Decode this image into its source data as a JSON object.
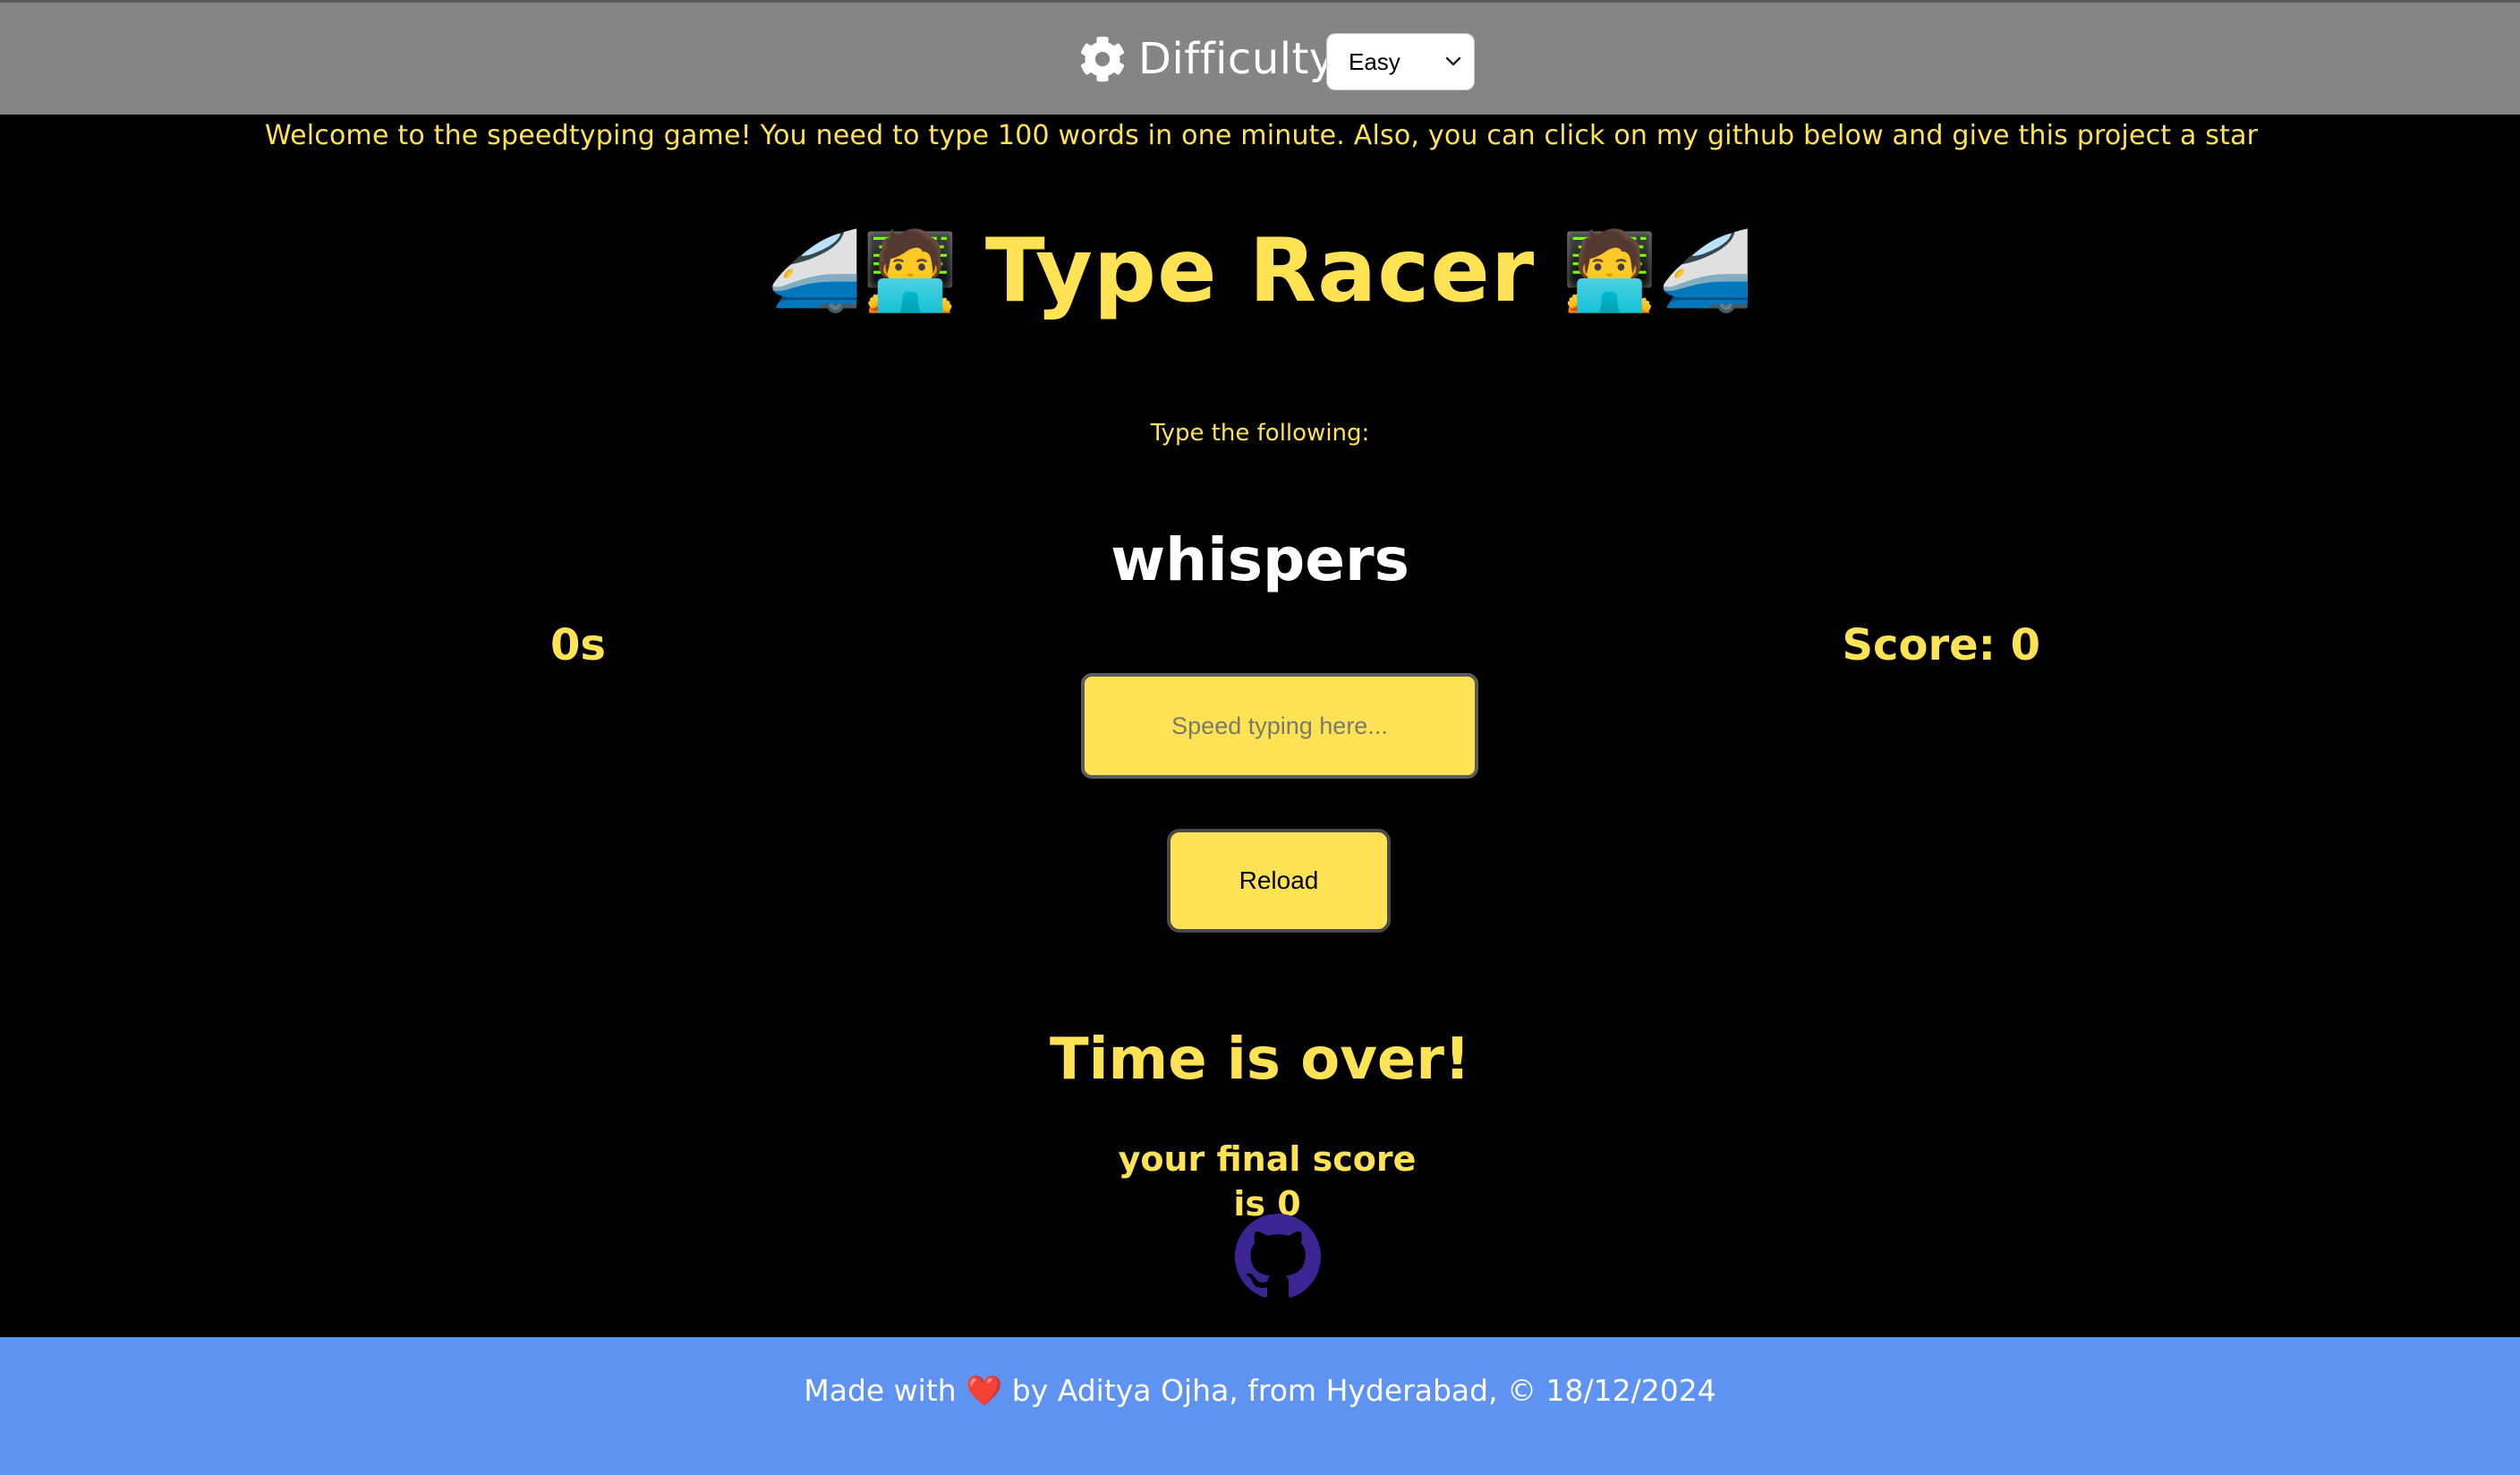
{
  "header": {
    "settings_label": "Difficulty",
    "settings_icon": "gear-icon",
    "difficulty_selected": "Easy"
  },
  "message": "Welcome to the speedtyping game! You need to type 100 words in one minute. Also, you can click on my github below and give this project a star",
  "title": {
    "text": "Type Racer",
    "left_emojis": "🚄🧑‍💻",
    "right_emojis": "🧑‍💻🚄"
  },
  "game": {
    "prompt": "Type the following:",
    "word": "whispers",
    "time_left": "0s",
    "score": "Score: 0",
    "input_placeholder": "Speed typing here...",
    "reload_label": "Reload"
  },
  "end_game": {
    "title": "Time is over!",
    "final_score": "your final score is 0"
  },
  "footer": {
    "text": "Made with ❤️ by Aditya Ojha, from Hyderabad, © 18/12/2024"
  },
  "colors": {
    "accent": "#ffe354",
    "header_bg": "#858585",
    "page_bg": "#000000",
    "footer_bg": "#5f93f2",
    "github_icon": "#3b2592"
  }
}
